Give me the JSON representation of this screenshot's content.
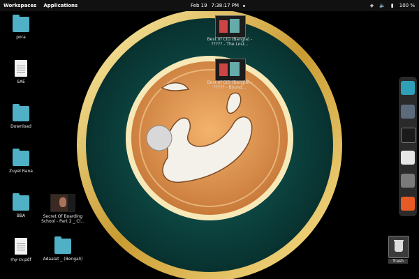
{
  "topbar": {
    "workspaces_label": "Workspaces",
    "applications_label": "Applications",
    "date": "Feb 19",
    "time": "7:38:17 PM",
    "battery": "100 %"
  },
  "desktop_icons": [
    {
      "label": "pora",
      "icon": "folder-icon"
    },
    {
      "label": "SAE",
      "icon": "document-icon"
    },
    {
      "label": "Download",
      "icon": "folder-icon"
    },
    {
      "label": "Zuyel Rana",
      "icon": "folder-icon"
    },
    {
      "label": "BBA",
      "icon": "folder-icon"
    },
    {
      "label": "Secret Of Boarding School - Part 2 _ Cl...",
      "icon": "video-thumbnail-icon"
    },
    {
      "label": "my-cv.pdf",
      "icon": "pdf-icon"
    },
    {
      "label": "Adaalat _ (Bengali)",
      "icon": "folder-icon"
    }
  ],
  "overlay_videos": [
    {
      "label": "Best of CID (Bangla) - ????? - The Lost..."
    },
    {
      "label": "Best of CID (Bangla) - ????? - Bound..."
    }
  ],
  "dock": {
    "items": [
      "search-app-icon",
      "apps-grid-icon",
      "terminal-icon",
      "installer-icon",
      "files-icon",
      "media-player-icon"
    ]
  },
  "trash": {
    "label": "Trash"
  },
  "colors": {
    "wallpaper_teal": "#0c4a47",
    "gold": "#d8b45a",
    "accent_blue": "#4fb0c6"
  }
}
